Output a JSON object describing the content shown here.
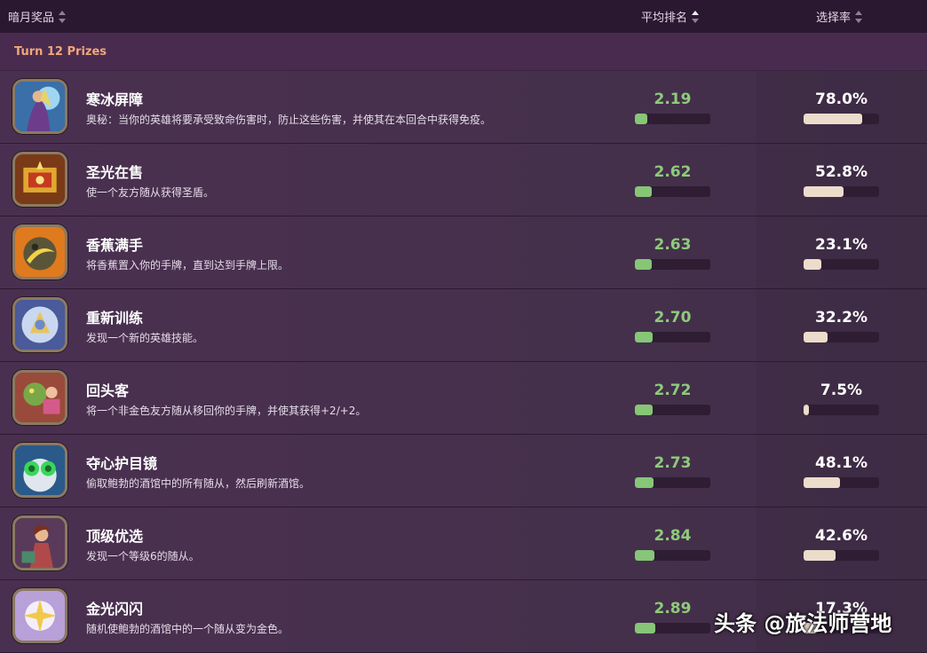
{
  "header": {
    "col_prize": "暗月奖品",
    "col_rank": "平均排名",
    "col_rate": "选择率"
  },
  "section": {
    "title": "Turn 12 Prizes"
  },
  "prizes": [
    {
      "name": "寒冰屏障",
      "desc": "奥秘：当你的英雄将要承受致命伤害时，防止这些伤害，并使其在本回合中获得免疫。",
      "rank": "2.19",
      "rank_fill": 0.16,
      "rate": "78.0%",
      "rate_fill": 0.78,
      "icon": "ice-barrier-icon"
    },
    {
      "name": "圣光在售",
      "desc": "使一个友方随从获得圣盾。",
      "rank": "2.62",
      "rank_fill": 0.22,
      "rate": "52.8%",
      "rate_fill": 0.528,
      "icon": "holy-sale-icon"
    },
    {
      "name": "香蕉满手",
      "desc": "将香蕉置入你的手牌，直到达到手牌上限。",
      "rank": "2.63",
      "rank_fill": 0.22,
      "rate": "23.1%",
      "rate_fill": 0.231,
      "icon": "banana-icon"
    },
    {
      "name": "重新训练",
      "desc": "发现一个新的英雄技能。",
      "rank": "2.70",
      "rank_fill": 0.24,
      "rate": "32.2%",
      "rate_fill": 0.322,
      "icon": "retrain-icon"
    },
    {
      "name": "回头客",
      "desc": "将一个非金色友方随从移回你的手牌，并使其获得+2/+2。",
      "rank": "2.72",
      "rank_fill": 0.24,
      "rate": "7.5%",
      "rate_fill": 0.075,
      "icon": "repeat-customer-icon"
    },
    {
      "name": "夺心护目镜",
      "desc": "偷取鲍勃的酒馆中的所有随从，然后刷新酒馆。",
      "rank": "2.73",
      "rank_fill": 0.25,
      "rate": "48.1%",
      "rate_fill": 0.481,
      "icon": "goggles-icon"
    },
    {
      "name": "顶级优选",
      "desc": "发现一个等级6的随从。",
      "rank": "2.84",
      "rank_fill": 0.26,
      "rate": "42.6%",
      "rate_fill": 0.426,
      "icon": "top-pick-icon"
    },
    {
      "name": "金光闪闪",
      "desc": "随机使鲍勃的酒馆中的一个随从变为金色。",
      "rank": "2.89",
      "rank_fill": 0.27,
      "rate": "17.3%",
      "rate_fill": 0.173,
      "icon": "golden-sparkle-icon"
    }
  ],
  "watermark": "头条 @旅法师营地"
}
